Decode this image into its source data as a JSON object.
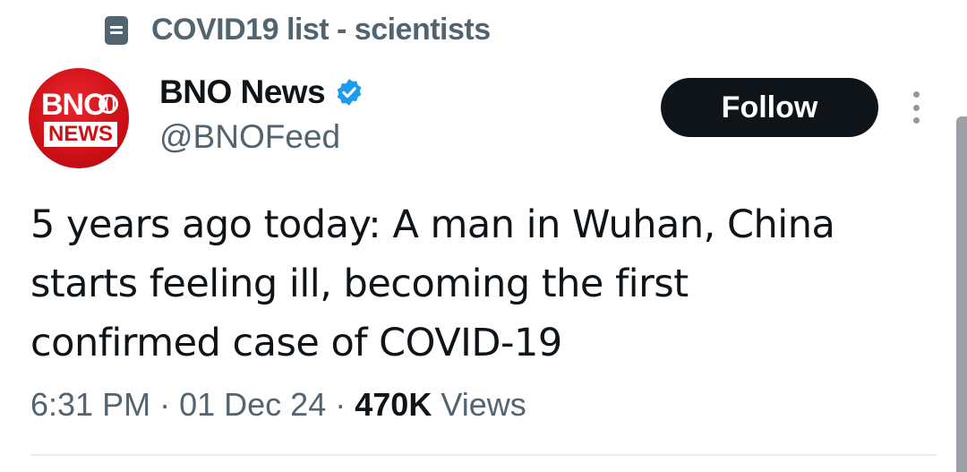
{
  "list_context": {
    "icon": "list-icon",
    "label": "COVID19 list - scientists"
  },
  "author": {
    "avatar_text_top": "BNO",
    "avatar_text_bottom": "NEWS",
    "display_name": "BNO News",
    "verified": true,
    "handle": "@BNOFeed"
  },
  "actions": {
    "follow_label": "Follow",
    "more_icon": "more-vertical-icon"
  },
  "tweet": {
    "text": "5 years ago today: A man in Wuhan, China starts feeling ill, becoming the first confirmed case of COVID-19",
    "time": "6:31 PM",
    "separator": "·",
    "date": "01 Dec 24",
    "views_count": "470K",
    "views_label": "Views"
  },
  "colors": {
    "brand_red": "#cc1016",
    "verified_blue": "#1d9bf0",
    "text_primary": "#0f1419",
    "text_secondary": "#536471",
    "button_dark": "#0f1419"
  }
}
